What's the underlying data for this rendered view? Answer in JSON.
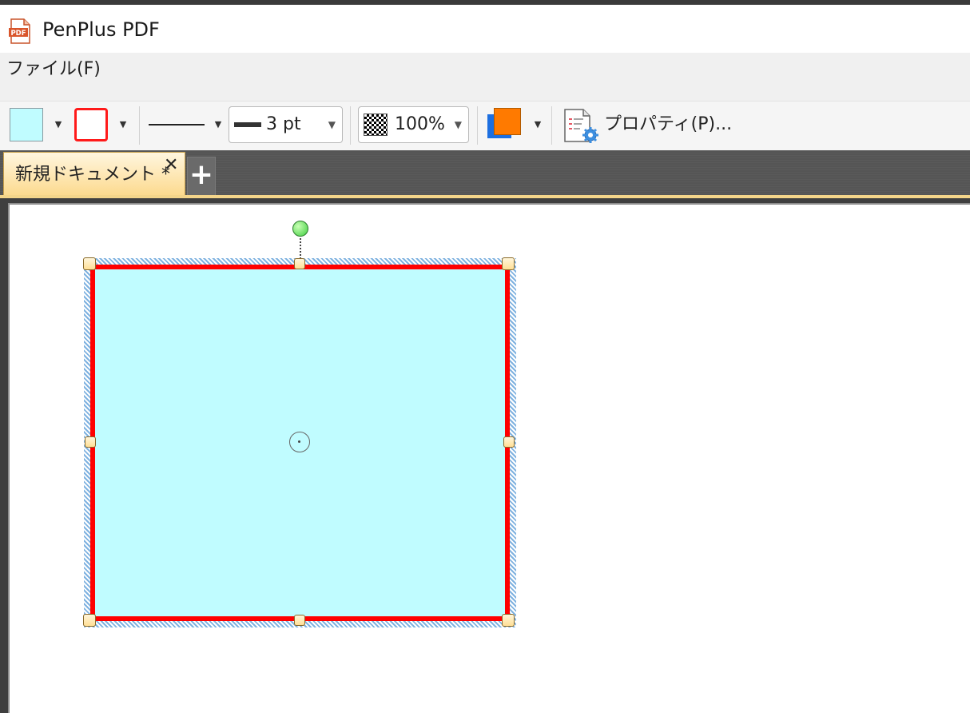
{
  "app": {
    "title": "PenPlus PDF",
    "icon": "pdf-icon"
  },
  "menu": {
    "items": [
      {
        "label": "ファイル(F)"
      }
    ]
  },
  "toolbar": {
    "fill_color": "#c0fcff",
    "stroke_color": "#ff0000",
    "line_width_label": "3 pt",
    "opacity_label": "100%",
    "color_front": "#ff7a00",
    "color_back": "#1d6fe0",
    "properties_label": "プロパティ(P)..."
  },
  "tabs": {
    "items": [
      {
        "label": "新規ドキュメント *",
        "active": true
      }
    ],
    "close_glyph": "✕",
    "add_glyph": "+"
  },
  "canvas": {
    "shape": {
      "type": "rectangle",
      "fill": "#c0fcff",
      "stroke": "#ff0000",
      "selected": true
    }
  }
}
